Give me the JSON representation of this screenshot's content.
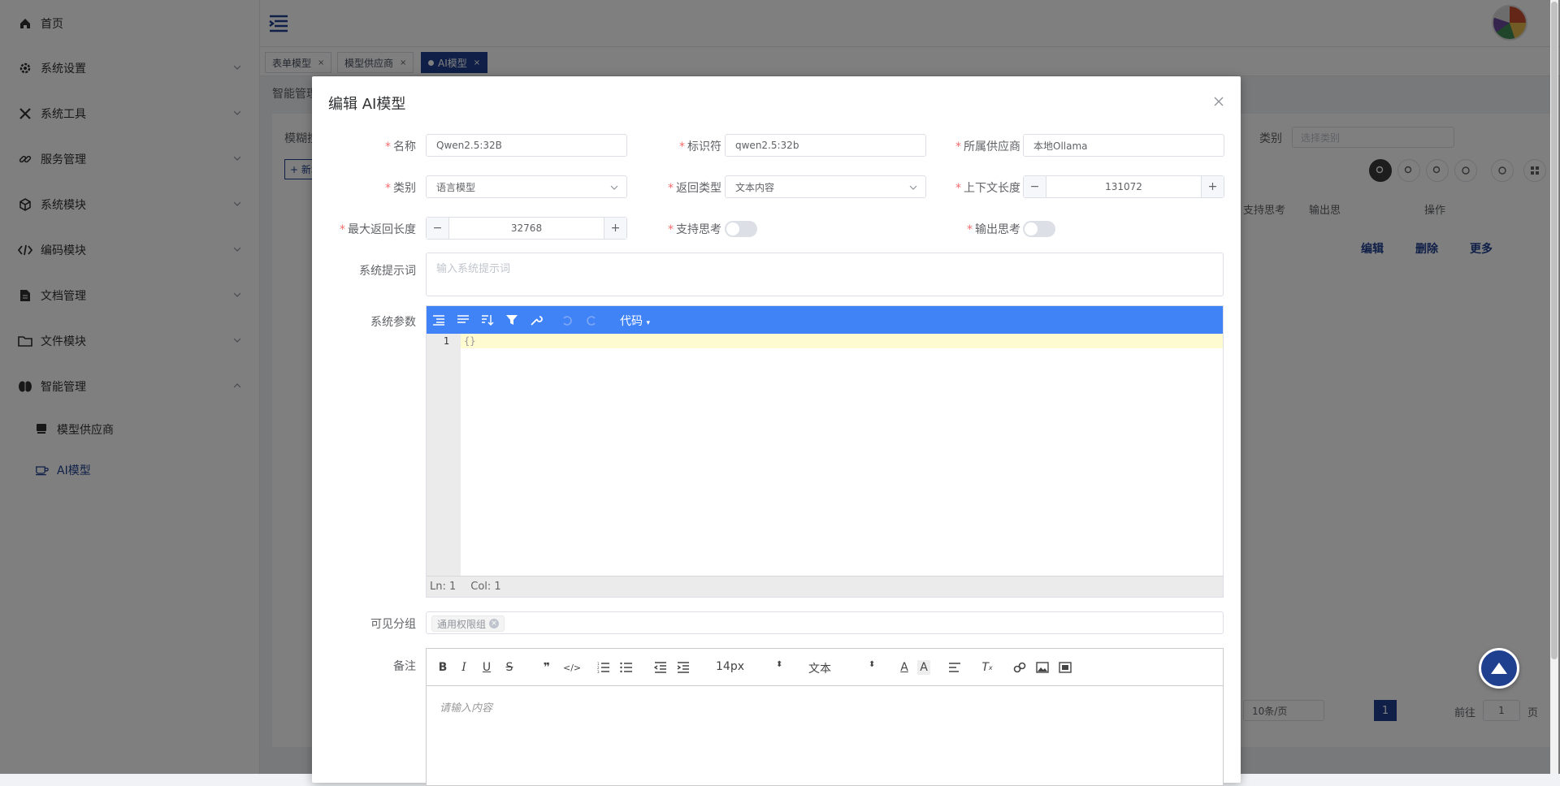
{
  "sidebar": {
    "items": [
      {
        "label": "首页",
        "icon": "home-icon"
      },
      {
        "label": "系统设置",
        "icon": "gear-icon"
      },
      {
        "label": "系统工具",
        "icon": "tools-icon"
      },
      {
        "label": "服务管理",
        "icon": "link-icon"
      },
      {
        "label": "系统模块",
        "icon": "cube-icon"
      },
      {
        "label": "编码模块",
        "icon": "code-icon"
      },
      {
        "label": "文档管理",
        "icon": "document-icon"
      },
      {
        "label": "文件模块",
        "icon": "folder-icon"
      },
      {
        "label": "智能管理",
        "icon": "brain-icon"
      }
    ],
    "sub_items": [
      {
        "label": "模型供应商",
        "icon": "stack-icon"
      },
      {
        "label": "AI模型",
        "icon": "cup-icon"
      }
    ]
  },
  "tabs": [
    {
      "label": "表单模型"
    },
    {
      "label": "模型供应商"
    },
    {
      "label": "AI模型"
    }
  ],
  "background": {
    "breadcrumb": "智能管理",
    "search_label": "模糊搜",
    "add_label": "+ 新增",
    "category_label": "类别",
    "category_placeholder": "选择类别",
    "col_support_thinking": "支持思考",
    "col_output": "输出思",
    "col_actions": "操作",
    "edit_link": "编辑",
    "delete_link": "删除",
    "more_link": "更多",
    "page_size": "10条/页",
    "current_page": "1",
    "goto_label": "前往",
    "goto_value": "1",
    "page_suffix": "页"
  },
  "dialog": {
    "title": "编辑 AI模型",
    "fields": {
      "name": {
        "label": "名称",
        "value": "Qwen2.5:32B"
      },
      "identifier": {
        "label": "标识符",
        "value": "qwen2.5:32b"
      },
      "provider": {
        "label": "所属供应商",
        "value": "本地Ollama"
      },
      "category": {
        "label": "类别",
        "value": "语言模型"
      },
      "return_type": {
        "label": "返回类型",
        "value": "文本内容"
      },
      "context_length": {
        "label": "上下文长度",
        "value": "131072"
      },
      "max_return_length": {
        "label": "最大返回长度",
        "value": "32768"
      },
      "support_thinking": {
        "label": "支持思考"
      },
      "output_thinking": {
        "label": "输出思考"
      },
      "system_prompt": {
        "label": "系统提示词",
        "placeholder": "输入系统提示词"
      },
      "system_params": {
        "label": "系统参数"
      },
      "visible_groups": {
        "label": "可见分组",
        "tag": "通用权限组"
      },
      "remark": {
        "label": "备注",
        "placeholder": "请输入内容"
      }
    },
    "editor": {
      "mode_label": "代码",
      "line_number": "1",
      "code": "{}",
      "status_ln": "Ln: 1",
      "status_col": "Col: 1"
    },
    "rte": {
      "font_size": "14px",
      "paragraph": "文本"
    }
  },
  "colors": {
    "primary": "#1f3f8f",
    "editor_toolbar": "#4083f7",
    "required": "#f56c6c"
  }
}
